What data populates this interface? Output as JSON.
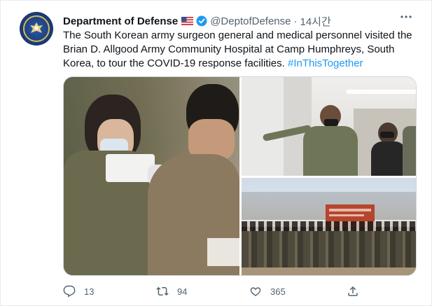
{
  "tweet": {
    "author_name": "Department of Defense",
    "handle": "@DeptofDefense",
    "separator": "·",
    "time": "14시간",
    "text_main": "The South Korean army surgeon general and medical personnel visited the Brian D. Allgood Army Community Hospital at Camp Humphreys, South Korea, to tour the COVID-19 response facilities. ",
    "hashtag": "#InThisTogether"
  },
  "media": {
    "photo_right_bottom_sign": "USAG Humphreys COVID-19 Vaccination Center"
  },
  "actions": {
    "reply_count": "13",
    "retweet_count": "94",
    "like_count": "365"
  },
  "colors": {
    "accent": "#1d9bf0",
    "text_secondary": "#536471",
    "verified": "#1d9bf0"
  },
  "icons": [
    "more-icon",
    "verified-badge-icon",
    "us-flag-icon",
    "reply-icon",
    "retweet-icon",
    "like-icon",
    "share-icon"
  ]
}
